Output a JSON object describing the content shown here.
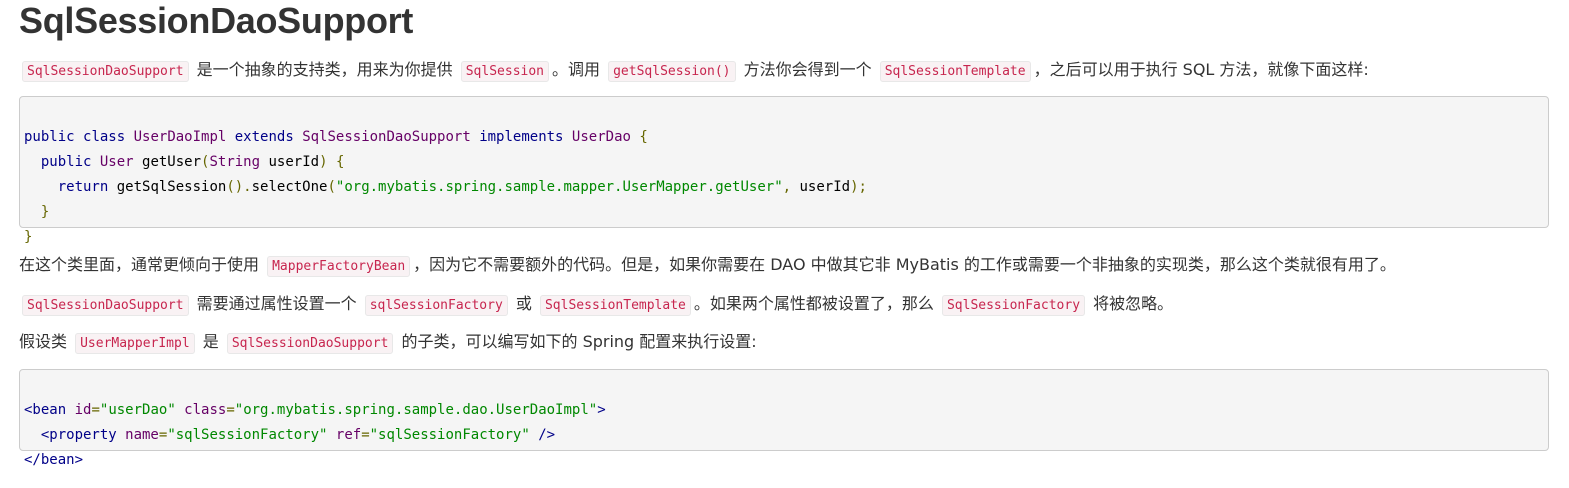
{
  "title": "SqlSessionDaoSupport",
  "intro": {
    "code1": "SqlSessionDaoSupport",
    "text1": " 是一个抽象的支持类，用来为你提供 ",
    "code2": "SqlSession",
    "text2": "。调用 ",
    "code3": "getSqlSession()",
    "text3": " 方法你会得到一个 ",
    "code4": "SqlSessionTemplate",
    "text4": "，之后可以用于执行 SQL 方法，就像下面这样:"
  },
  "java_code": {
    "line1": {
      "a": "public",
      "b": " ",
      "c": "class",
      "d": " UserDaoImpl ",
      "e": "extends",
      "f": " SqlSessionDaoSupport ",
      "g": "implements",
      "h": " UserDao ",
      "i": "{"
    },
    "line2": {
      "a": "  ",
      "b": "public",
      "c": " ",
      "d": "User",
      "e": " getUser",
      "f": "(",
      "g": "String",
      "h": " userId",
      "i": ")",
      "j": " ",
      "k": "{"
    },
    "line3": {
      "a": "    ",
      "b": "return",
      "c": " getSqlSession",
      "d": "().",
      "e": "selectOne",
      "f": "(",
      "g": "\"org.mybatis.spring.sample.mapper.UserMapper.getUser\"",
      "h": ",",
      "i": " userId",
      "j": ");"
    },
    "line4": {
      "a": "  ",
      "b": "}"
    },
    "line5": {
      "a": "}"
    }
  },
  "para2": {
    "text1": "在这个类里面，通常更倾向于使用 ",
    "code1": "MapperFactoryBean",
    "text2": "，因为它不需要额外的代码。但是，如果你需要在 DAO 中做其它非 MyBatis 的工作或需要一个非抽象的实现类，那么这个类就很有用了。"
  },
  "para3": {
    "code1": "SqlSessionDaoSupport",
    "text1": " 需要通过属性设置一个 ",
    "code2": "sqlSessionFactory",
    "text2": " 或 ",
    "code3": "SqlSessionTemplate",
    "text3": "。如果两个属性都被设置了，那么 ",
    "code4": "SqlSessionFactory",
    "text4": " 将被忽略。"
  },
  "para4": {
    "text1": "假设类 ",
    "code1": "UserMapperImpl",
    "text2": " 是 ",
    "code2": "SqlSessionDaoSupport",
    "text3": " 的子类，可以编写如下的 Spring 配置来执行设置:"
  },
  "xml_code": {
    "line1": {
      "a": "<bean",
      "b": " id",
      "c": "=",
      "d": "\"userDao\"",
      "e": " class",
      "f": "=",
      "g": "\"org.mybatis.spring.sample.dao.UserDaoImpl\"",
      "h": ">"
    },
    "line2": {
      "a": "  ",
      "b": "<property",
      "c": " name",
      "d": "=",
      "e": "\"sqlSessionFactory\"",
      "f": " ref",
      "g": "=",
      "h": "\"sqlSessionFactory\"",
      "i": " />"
    },
    "line3": {
      "a": "</bean>"
    }
  }
}
